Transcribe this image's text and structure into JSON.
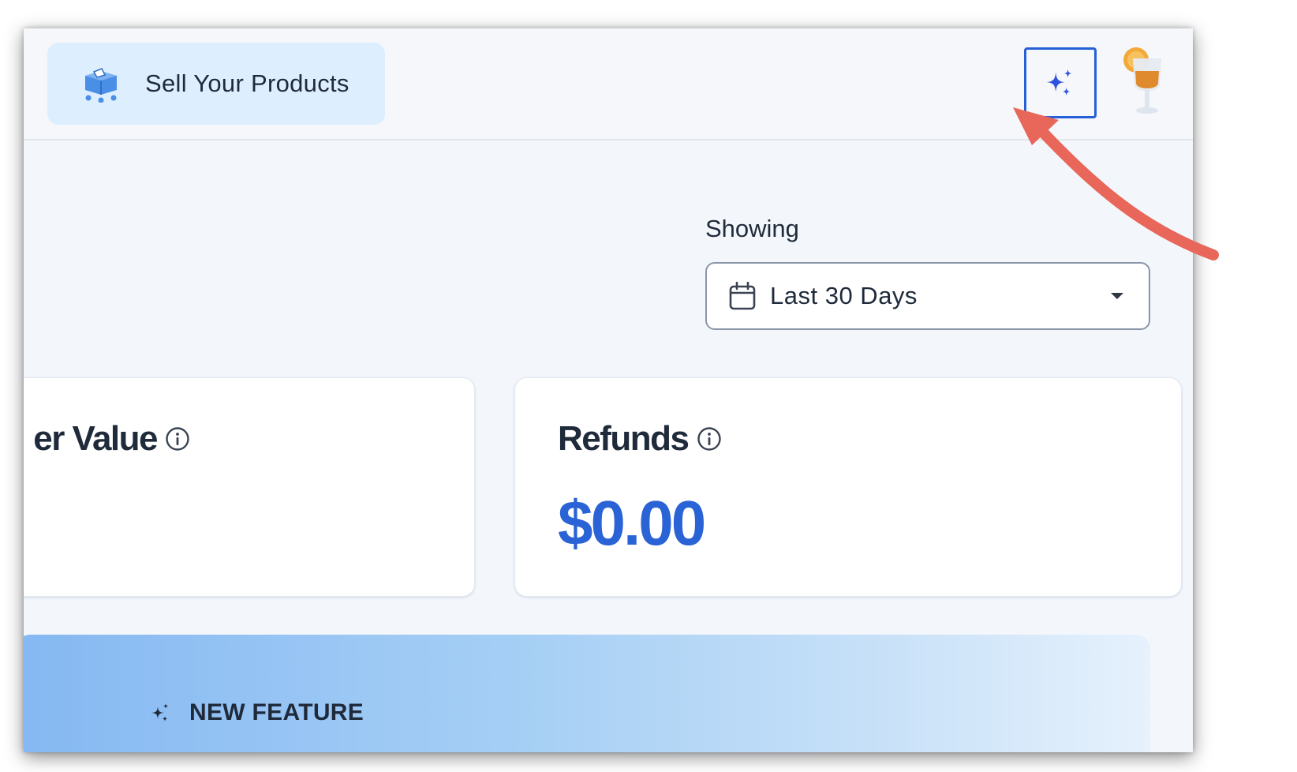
{
  "header": {
    "sell_button_label": "Sell Your Products",
    "store_icon": "store-cart-icon",
    "ai_button_icon": "sparkles-icon",
    "avatar_icon": "drink-glass-avatar"
  },
  "filter": {
    "label": "Showing",
    "selected_range": "Last 30 Days",
    "icon": "calendar-icon"
  },
  "cards": {
    "left": {
      "title": "er Value",
      "info_icon": "info-icon"
    },
    "right": {
      "title": "Refunds",
      "value": "$0.00",
      "info_icon": "info-icon"
    }
  },
  "banner": {
    "tag_icon": "sparkles-icon",
    "tag_label": "NEW FEATURE"
  },
  "colors": {
    "accent": "#2a63d6",
    "annotation_arrow": "#e8675a"
  }
}
